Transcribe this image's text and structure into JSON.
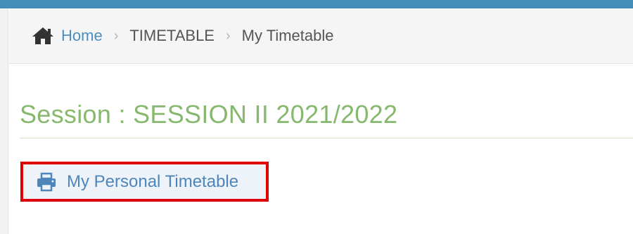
{
  "breadcrumb": {
    "home_icon": "home-icon",
    "items": [
      {
        "label": "Home"
      },
      {
        "label": "TIMETABLE"
      },
      {
        "label": "My Timetable"
      }
    ],
    "separator": "›"
  },
  "page_header": {
    "title": "Session : SESSION II 2021/2022"
  },
  "actions": {
    "personal_timetable_label": "My Personal Timetable",
    "personal_timetable_icon": "print-icon"
  },
  "colors": {
    "top_bar": "#438eb9",
    "link": "#4c8fbd",
    "title": "#86b86e",
    "highlight_border": "#e00000"
  }
}
